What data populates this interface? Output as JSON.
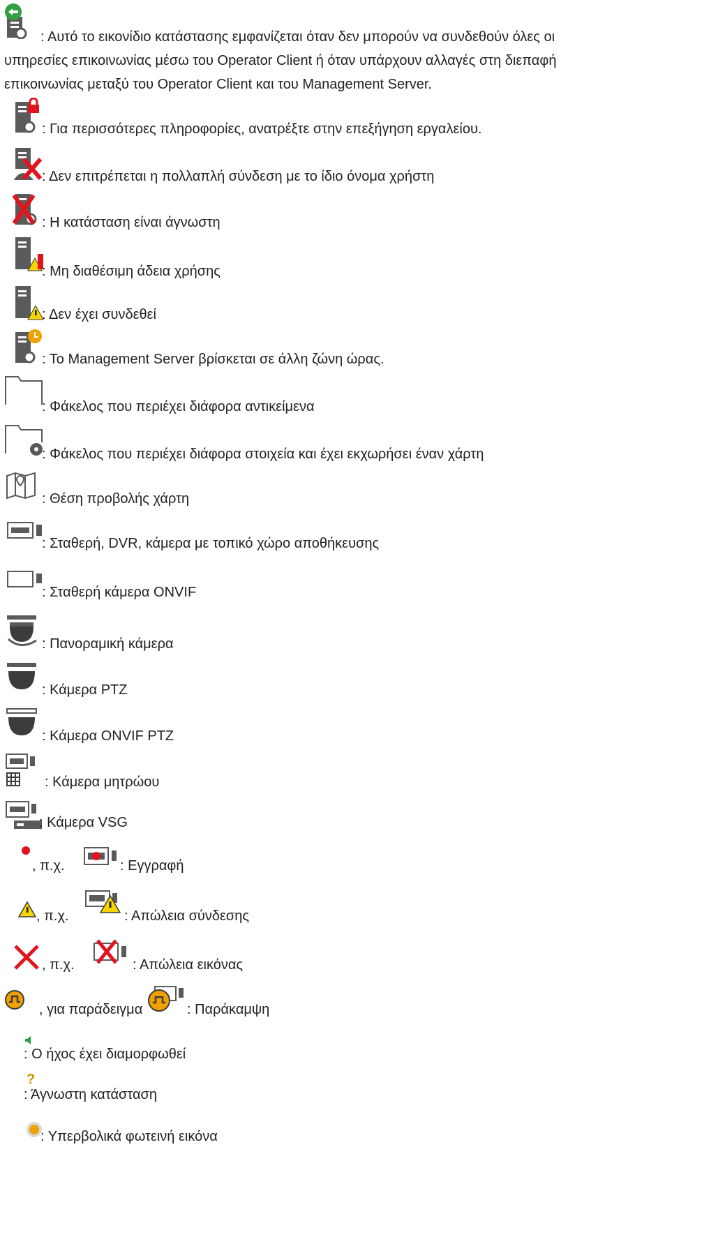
{
  "lines": {
    "status_comm_1": ": Αυτό το εικονίδιο κατάστασης εμφανίζεται όταν δεν μπορούν να συνδεθούν όλες οι",
    "status_comm_2": "υπηρεσίες επικοινωνίας μέσω του Operator Client ή όταν υπάρχουν αλλαγές στη διεπαφή",
    "status_comm_3": "επικοινωνίας μεταξύ του Operator Client και του Management Server.",
    "tooltip_info": ": Για περισσότερες πληροφορίες, ανατρέξτε στην επεξήγηση εργαλείου.",
    "multi_login": ": Δεν επιτρέπεται η πολλαπλή σύνδεση με το ίδιο όνομα χρήστη",
    "unknown_state": ": Η κατάσταση είναι άγνωστη",
    "no_license": ": Μη διαθέσιμη άδεια χρήσης",
    "not_connected": ": Δεν έχει συνδεθεί",
    "time_zone": ": Το Management Server βρίσκεται σε άλλη ζώνη ώρας.",
    "folder": ": Φάκελος που περιέχει διάφορα αντικείμενα",
    "folder_map": ": Φάκελος που περιέχει διάφορα στοιχεία και έχει εκχωρήσει έναν χάρτη",
    "map_view": ": Θέση προβολής χάρτη",
    "fixed_camera": ": Σταθερή, DVR, κάμερα με τοπικό χώρο αποθήκευσης",
    "onvif_fixed": ": Σταθερή κάμερα ONVIF",
    "panoramic": ": Πανοραμική κάμερα",
    "ptz": ": Κάμερα PTZ",
    "onvif_ptz": ": Κάμερα ONVIF PTZ",
    "matrix": ": Κάμερα μητρώου",
    "vsg": ": Κάμερα VSG",
    "eg": ", π.χ.",
    "recording": ": Εγγραφή",
    "conn_lost": ": Απώλεια σύνδεσης",
    "image_lost": ": Απώλεια εικόνας",
    "for_example": ", για παράδειγμα",
    "bypass": ": Παράκαμψη",
    "audio": ": Ο ήχος έχει διαμορφωθεί",
    "unknown": ": Άγνωστη κατάσταση",
    "overbright": ": Υπερβολικά φωτεινή εικόνα"
  },
  "colors": {
    "icon_gray": "#5a5a5a",
    "icon_dark": "#3c3c3c",
    "red": "#e0141e",
    "green": "#2ea043",
    "yellow": "#f5d400",
    "orange": "#f0a000"
  }
}
